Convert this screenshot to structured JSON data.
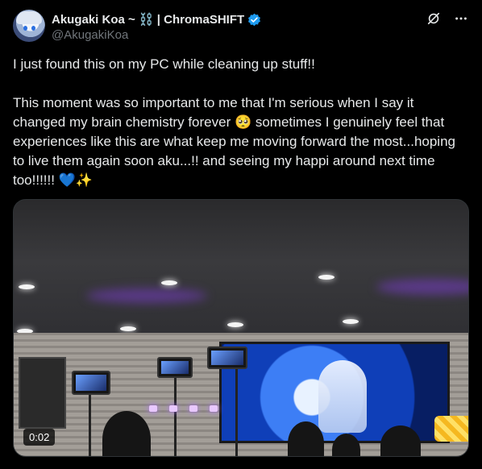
{
  "author": {
    "display_name": "Akugaki Koa ~ ⛓️ | ChromaSHIFT",
    "handle": "@AkugakiKoa"
  },
  "tweet": {
    "text": "I just found this on my PC while cleaning up stuff!!\n\nThis moment was so important to me that I'm serious when I say it changed my brain chemistry forever 🥺 sometimes I genuinely feel that experiences like this are what keep me moving forward the most...hoping to live them again soon aku...!! and seeing my happi around next time too!!!!!! 💙✨"
  },
  "media": {
    "type": "video",
    "timestamp": "0:02"
  },
  "icons": {
    "verified": "verified-badge-icon",
    "grok": "grok-icon",
    "more": "more-icon"
  },
  "colors": {
    "background": "#000000",
    "text": "#e7e9ea",
    "secondary_text": "#71767b",
    "verified": "#1d9bf0"
  }
}
